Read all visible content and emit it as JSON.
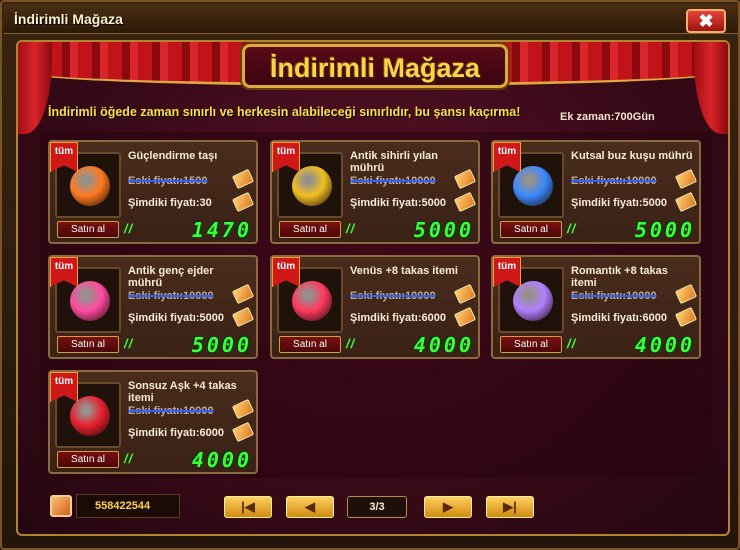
{
  "window": {
    "title": "İndirimli Mağaza",
    "close_label": "✖"
  },
  "banner": {
    "title": "İndirimli Mağaza"
  },
  "notice": "İndirimli öğede zaman sınırlı ve herkesin alabileceği sınırlıdır, bu şansı kaçırma!",
  "extra_time": "Ek zaman:700Gün",
  "items": [
    {
      "tag": "tüm",
      "name": "Güçlendirme taşı",
      "old_price": "Eski fiyatı:1500",
      "new_price": "Şimdiki fiyatı:30",
      "buy": "Satın al",
      "marker": "//",
      "total": "1470",
      "icon": "orange-crystal-icon",
      "gem_color": "#ff7a20"
    },
    {
      "tag": "tüm",
      "name": "Antik sihirli yılan mührü",
      "old_price": "Eski fiyatı:10000",
      "new_price": "Şimdiki fiyatı:5000",
      "buy": "Satın al",
      "marker": "//",
      "total": "5000",
      "icon": "gold-seal-icon",
      "gem_color": "#f0c020"
    },
    {
      "tag": "tüm",
      "name": "Kutsal buz kuşu mührü",
      "old_price": "Eski fiyatı:10000",
      "new_price": "Şimdiki fiyatı:5000",
      "buy": "Satın al",
      "marker": "//",
      "total": "5000",
      "icon": "blue-seal-icon",
      "gem_color": "#3a8aff"
    },
    {
      "tag": "tüm",
      "name": "Antik genç ejder mührü",
      "old_price": "Eski fiyatı:10000",
      "new_price": "Şimdiki fiyatı:5000",
      "buy": "Satın al",
      "marker": "//",
      "total": "5000",
      "icon": "pink-seal-icon",
      "gem_color": "#ff4aa0"
    },
    {
      "tag": "tüm",
      "name": "Venüs +8 takas itemi",
      "old_price": "Eski fiyatı:10000",
      "new_price": "Şimdiki fiyatı:6000",
      "buy": "Satın al",
      "marker": "//",
      "total": "4000",
      "icon": "winged-heart-icon",
      "gem_color": "#ff3a60"
    },
    {
      "tag": "tüm",
      "name": "Romantık +8 takas itemi",
      "old_price": "Eski fiyatı:10000",
      "new_price": "Şimdiki fiyatı:6000",
      "buy": "Satın al",
      "marker": "//",
      "total": "4000",
      "icon": "winged-gem-icon",
      "gem_color": "#b080ff"
    },
    {
      "tag": "tüm",
      "name": "Sonsuz Aşk +4 takas itemi",
      "old_price": "Eski fiyatı:10000",
      "new_price": "Şimdiki fiyatı:6000",
      "buy": "Satın al",
      "marker": "//",
      "total": "4000",
      "icon": "heart-box-icon",
      "gem_color": "#e82030"
    }
  ],
  "footer": {
    "balance": "558422544",
    "page": "3/3",
    "first_label": "|◀",
    "prev_label": "◀",
    "next_label": "▶",
    "last_label": "▶|"
  }
}
